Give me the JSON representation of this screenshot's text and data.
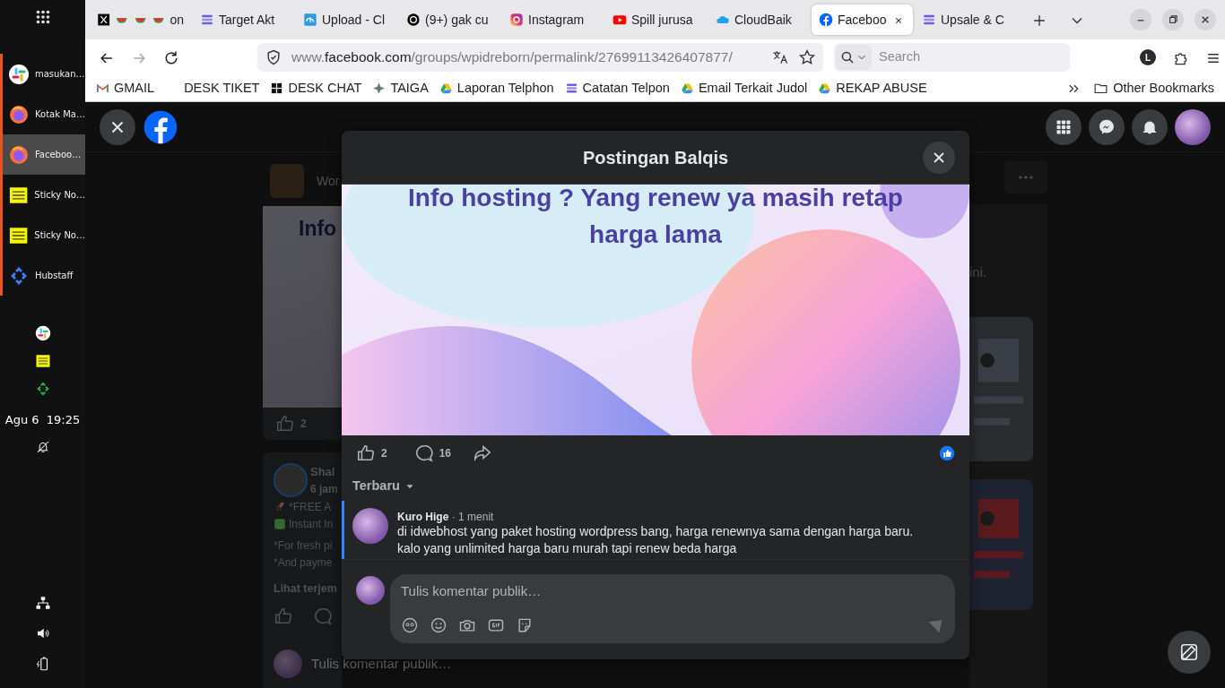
{
  "dock": {
    "apps": [
      {
        "label": "masukan…",
        "kind": "slack",
        "selected": false
      },
      {
        "label": "Kotak Ma…",
        "kind": "firefox",
        "selected": false
      },
      {
        "label": "Faceboo…",
        "kind": "firefox",
        "selected": true
      },
      {
        "label": "Sticky No…",
        "kind": "sticky",
        "selected": false
      },
      {
        "label": "Sticky No…",
        "kind": "sticky",
        "selected": false
      },
      {
        "label": "Hubstaff",
        "kind": "hubstaff",
        "selected": false
      }
    ],
    "tray": [
      {
        "kind": "slack"
      },
      {
        "kind": "sticky"
      },
      {
        "kind": "hubstaff-green"
      }
    ],
    "clock": {
      "date": "Agu 6",
      "time": "19:25"
    },
    "indicators": [
      {
        "kind": "bell-off"
      },
      {
        "kind": "network"
      },
      {
        "kind": "volume"
      },
      {
        "kind": "battery"
      }
    ]
  },
  "browser": {
    "tabs": [
      {
        "kind": "x",
        "title": "on",
        "selected": false
      },
      {
        "kind": "tasks",
        "title": "Target Akt",
        "selected": false
      },
      {
        "kind": "ch",
        "title": "Upload - Cl",
        "selected": false
      },
      {
        "kind": "threads",
        "title": "(9+) gak cu",
        "selected": false
      },
      {
        "kind": "instagram",
        "title": "Instagram",
        "selected": false
      },
      {
        "kind": "youtube",
        "title": "Spill jurusa",
        "selected": false
      },
      {
        "kind": "cloud",
        "title": "CloudBaik",
        "selected": false
      },
      {
        "kind": "facebook",
        "title": "Faceboo",
        "selected": true
      },
      {
        "kind": "tasks",
        "title": "Upsale & C",
        "selected": false
      }
    ],
    "address": {
      "prefix": "www.",
      "domain": "facebook.com",
      "path": "/groups/wpidreborn/permalink/27699113426407877/"
    },
    "search_placeholder": "Search",
    "profile_initial": "L",
    "bookmarks": [
      {
        "kind": "gmail",
        "label": "GMAIL"
      },
      {
        "kind": "plain",
        "label": "DESK TIKET"
      },
      {
        "kind": "deskchat",
        "label": "DESK CHAT"
      },
      {
        "kind": "taiga",
        "label": "TAIGA"
      },
      {
        "kind": "drive",
        "label": "Laporan Telphon"
      },
      {
        "kind": "tasks",
        "label": "Catatan Telpon"
      },
      {
        "kind": "drive",
        "label": "Email Terkait Judol"
      },
      {
        "kind": "drive",
        "label": "REKAP ABUSE"
      }
    ],
    "other_bookmarks": "Other Bookmarks"
  },
  "background": {
    "group_name": "Wor",
    "image_text": "Info",
    "likes": "2",
    "author": "Shal",
    "time": "6 jam",
    "lines": [
      {
        "kind": "rocket",
        "text": "*FREE A"
      },
      {
        "kind": "check",
        "text": "Instant In"
      },
      {
        "kind": "plain",
        "text": "*For fresh pi"
      },
      {
        "kind": "plain",
        "text": "*And payme"
      }
    ],
    "see_translation": "Lihat terjem",
    "side_text": "ini.",
    "composer_placeholder": "Tulis komentar publik…"
  },
  "modal": {
    "title": "Postingan Balqis",
    "image_lines": [
      "Info hosting ? Yang renew ya masih retap",
      "harga lama"
    ],
    "likes": "2",
    "comments": "16",
    "sort": "Terbaru",
    "comments_list": [
      {
        "author": "Kuro Hige",
        "separator": "·",
        "time": "1 menit",
        "lines": [
          "di idwebhost yang paket hosting wordpress bang, harga renewnya sama dengan harga baru.",
          "kalo yang unlimited harga baru murah tapi renew beda harga"
        ],
        "highlighted": true
      }
    ],
    "composer_placeholder": "Tulis komentar publik…"
  }
}
